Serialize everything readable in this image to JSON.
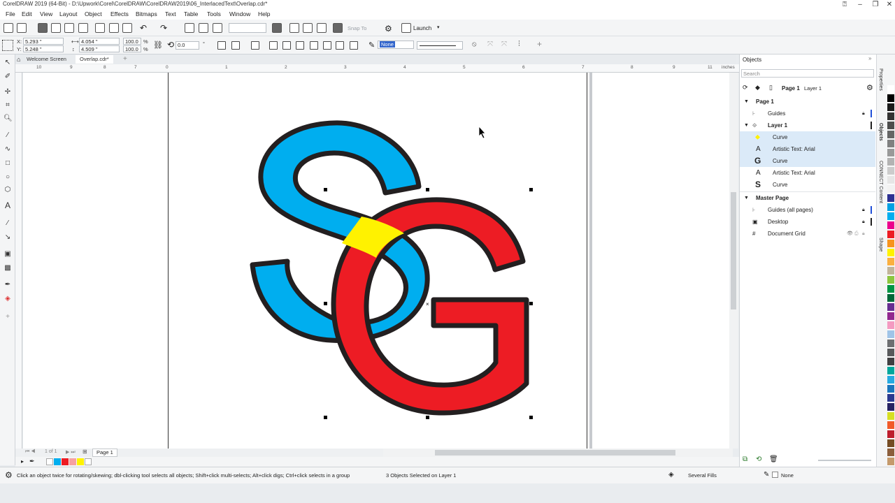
{
  "titlebar": {
    "title": "CorelDRAW 2019 (64-Bit) - D:\\Upwork\\Corel\\CorelDRAW\\CorelDRAW2019\\06_InterlacedText\\Overlap.cdr*",
    "minimize": "–",
    "restore": "❐",
    "close": "✕"
  },
  "menubar": {
    "items": [
      "File",
      "Edit",
      "View",
      "Layout",
      "Object",
      "Effects",
      "Bitmaps",
      "Text",
      "Table",
      "Tools",
      "Window",
      "Help"
    ]
  },
  "toolbar": {
    "snap_to": "Snap To",
    "launch": "Launch"
  },
  "propbar": {
    "x_label": "X:",
    "x_value": "5.293 \"",
    "y_label": "Y:",
    "y_value": "5.248 \"",
    "w_value": "4.054 \"",
    "h_value": "4.509 \"",
    "scale_w": "100.0",
    "scale_h": "100.0",
    "scale_unit": "%",
    "rotation": "0.0",
    "rotation_unit": "°",
    "outline_width": "None"
  },
  "tabs": [
    "Welcome Screen",
    "Overlap.cdr*"
  ],
  "tab_add": "+",
  "ruler": {
    "labels": [
      "10",
      "9",
      "8",
      "7",
      "6",
      "5",
      "4",
      "3",
      "2",
      "1",
      "0",
      "1",
      "2",
      "3",
      "4",
      "5",
      "6",
      "7",
      "8",
      "9",
      "10",
      "11"
    ],
    "unit": "inches"
  },
  "pagenav": {
    "counter": "1 of 1",
    "page_tab": "Page 1"
  },
  "docker": {
    "title": "Objects",
    "search_placeholder": "Search",
    "page_label": "Page 1",
    "layer_label": "Layer 1",
    "tree": [
      {
        "label": "Page 1",
        "bold": true,
        "indent": 0,
        "icon": "expand-arrow"
      },
      {
        "label": "Guides",
        "bold": false,
        "indent": 1,
        "icon": "guides-icon"
      },
      {
        "label": "Layer 1",
        "bold": true,
        "indent": 1,
        "icon": "layer-icon"
      },
      {
        "label": "Curve",
        "bold": false,
        "indent": 2,
        "icon": "curve-icon",
        "selected": true
      },
      {
        "label": "Artistic Text: Arial",
        "bold": false,
        "indent": 2,
        "icon": "text-A-icon",
        "selected": true
      },
      {
        "label": "Curve",
        "bold": false,
        "indent": 2,
        "icon": "G-glyph-icon",
        "selected": true
      },
      {
        "label": "Artistic Text: Arial",
        "bold": false,
        "indent": 2,
        "icon": "text-A-icon"
      },
      {
        "label": "Curve",
        "bold": false,
        "indent": 2,
        "icon": "S-glyph-icon"
      },
      {
        "label": "Master Page",
        "bold": true,
        "indent": 0,
        "icon": "expand-arrow"
      },
      {
        "label": "Guides (all pages)",
        "bold": false,
        "indent": 1,
        "icon": "guides-icon"
      },
      {
        "label": "Desktop",
        "bold": false,
        "indent": 1,
        "icon": "desktop-icon"
      },
      {
        "label": "Document Grid",
        "bold": false,
        "indent": 1,
        "icon": "grid-icon"
      }
    ]
  },
  "sidetabs": [
    "Properties",
    "Objects",
    "CONNECT Content",
    "Shape"
  ],
  "palette": [
    "#ffffff",
    "#000000",
    "#1a1a1a",
    "#333333",
    "#4d4d4d",
    "#666666",
    "#808080",
    "#999999",
    "#b3b3b3",
    "#cccccc",
    "#e6e6e6",
    "#f2f2f2",
    "#2e3192",
    "#00a0e3",
    "#00aeef",
    "#ec008c",
    "#ed1c24",
    "#f7941d",
    "#fff200",
    "#fbb040",
    "#c2b59b",
    "#8dc63f",
    "#009444",
    "#006838",
    "#662d91",
    "#92278f",
    "#f49ac1",
    "#a0c4e8",
    "#6d6e71",
    "#58595b",
    "#414042",
    "#00a79d",
    "#27aae1",
    "#1b75bc",
    "#2b3990",
    "#262262",
    "#d7df23",
    "#f15a29",
    "#be1e2d",
    "#754c24",
    "#8b5e3c",
    "#c49a6c"
  ],
  "status": {
    "hint": "Click an object twice for rotating/skewing; dbl-clicking tool selects all objects; Shift+click multi-selects; Alt+click digs; Ctrl+click selects in a group",
    "selection": "3 Objects Selected on Layer 1",
    "fill": "Several Fills",
    "outline": "None"
  },
  "colors": {
    "blue": "#00aeef",
    "red": "#ed1c24",
    "yellow": "#fff200",
    "outline": "#231f20",
    "highlight_ring": "#e21b23",
    "selection_row": "#dbeaf8"
  }
}
